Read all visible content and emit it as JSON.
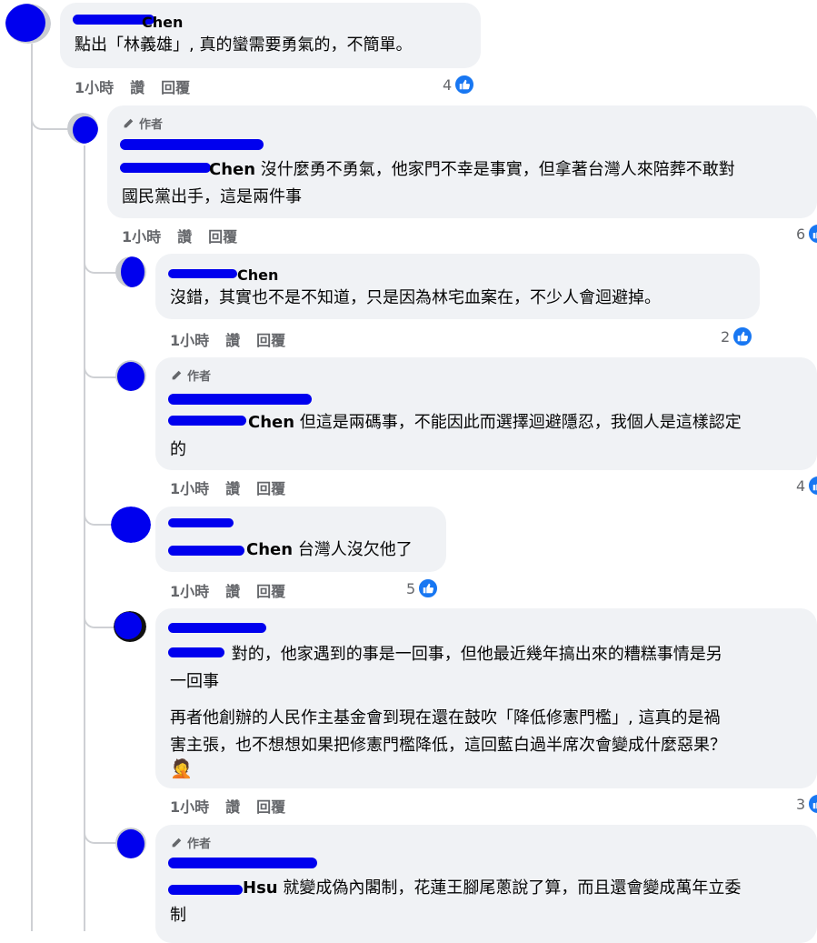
{
  "colors": {
    "accent": "#1877f2",
    "bubble": "#f0f2f5",
    "muted": "#65676b",
    "redaction": "#0000ee"
  },
  "comments": [
    {
      "author_tag": "",
      "name": "Chen",
      "mention": "",
      "text_lines": [
        "點出「林義雄」, 真的蠻需要勇氣的，不簡單。"
      ],
      "time": "1小時",
      "like_label": "讚",
      "reply_label": "回覆",
      "likes": "4"
    },
    {
      "author_tag": "作者",
      "name": "",
      "mention": "Chen",
      "text_lines": [
        " 沒什麼勇不勇氣，他家門不幸是事實，但拿著台灣人來陪葬不敢對",
        "國民黨出手，這是兩件事"
      ],
      "time": "1小時",
      "like_label": "讚",
      "reply_label": "回覆",
      "likes": "6"
    },
    {
      "author_tag": "",
      "name": "Chen",
      "mention": "",
      "text_lines": [
        "沒錯，其實也不是不知道，只是因為林宅血案在，不少人會迴避掉。"
      ],
      "time": "1小時",
      "like_label": "讚",
      "reply_label": "回覆",
      "likes": "2"
    },
    {
      "author_tag": "作者",
      "name": "",
      "mention": "Chen",
      "text_lines": [
        " 但這是兩碼事，不能因此而選擇迴避隱忍，我個人是這樣認定",
        "的"
      ],
      "time": "1小時",
      "like_label": "讚",
      "reply_label": "回覆",
      "likes": "4"
    },
    {
      "author_tag": "",
      "name": "",
      "mention": "Chen",
      "text_lines": [
        " 台灣人沒欠他了"
      ],
      "time": "1小時",
      "like_label": "讚",
      "reply_label": "回覆",
      "likes": "5"
    },
    {
      "author_tag": "",
      "name": "",
      "mention": "",
      "text_lines": [
        " 對的，他家遇到的事是一回事，但他最近幾年搞出來的糟糕事情是另",
        "一回事",
        "再者他創辦的人民作主基金會到現在還在鼓吹「降低修憲門檻」, 這真的是禍",
        "害主張，也不想想如果把修憲門檻降低，這回藍白過半席次會變成什麼惡果？"
      ],
      "emoji": "🤦",
      "time": "1小時",
      "like_label": "讚",
      "reply_label": "回覆",
      "likes": "3"
    },
    {
      "author_tag": "作者",
      "name": "",
      "mention": "Hsu",
      "text_lines": [
        " 就變成偽內閣制，花蓮王腳尾蔥說了算，而且還會變成萬年立委",
        "制"
      ]
    }
  ]
}
